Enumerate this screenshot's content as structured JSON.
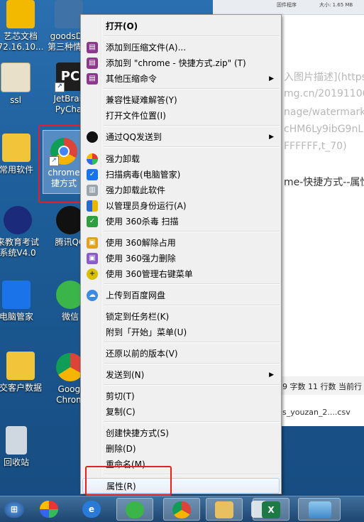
{
  "desktop_icons": [
    {
      "label1": "艺芯文档",
      "label2": "72.16.10...",
      "icon": "document-icon",
      "color": "#f2b900"
    },
    {
      "label1": "goodsDe",
      "label2": "第三种情况",
      "icon": "python-icon",
      "color": "#3f73a8"
    },
    {
      "label1": "ssl",
      "label2": "",
      "icon": "certificate-icon",
      "color": "#e8e0c8"
    },
    {
      "label1": "JetBrain",
      "label2": "PyChar",
      "icon": "pycharm-icon",
      "color": "#1e1e1e"
    },
    {
      "label1": "常用软件",
      "label2": "",
      "icon": "folder-icon",
      "color": "#f2c43a"
    },
    {
      "label1": "chrome",
      "label2": "捷方式",
      "icon": "chrome-icon",
      "color": "#db4437"
    },
    {
      "label1": "来教育考试",
      "label2": "系统V4.0",
      "icon": "exam-app-icon",
      "color": "#1b2a7a"
    },
    {
      "label1": "腾讯QQ",
      "label2": "",
      "icon": "qq-penguin-icon",
      "color": "#111"
    },
    {
      "label1": "电脑管家",
      "label2": "",
      "icon": "tencent-shield-icon",
      "color": "#1a73e8"
    },
    {
      "label1": "微信",
      "label2": "",
      "icon": "wechat-icon",
      "color": "#3bb54a"
    },
    {
      "label1": "交客户数据",
      "label2": "",
      "icon": "folder-icon",
      "color": "#f2c43a"
    },
    {
      "label1": "Googl",
      "label2": "Chrom",
      "icon": "chrome-icon",
      "color": "#db4437"
    },
    {
      "label1": "回收站",
      "label2": "",
      "icon": "recycle-bin-icon",
      "color": "#cfd8e0"
    }
  ],
  "background_window": {
    "topstrip_left": "固件程序",
    "topstrip_right": "大小: 1.65 MB",
    "lines": [
      "入图片描述](https",
      "mg.cn/201911061",
      "nage/watermark,ty",
      "cHM6Ly9ibG9nLm",
      "FFFFFF,t_70)"
    ],
    "dark_line": "me-快捷方式--属性",
    "status": "9 字数  11 行数  当前行",
    "csv_file": "s_youzan_2....csv"
  },
  "menu": {
    "items": [
      {
        "label": "打开(O)",
        "bold": true,
        "icon": "",
        "submenu": false
      },
      {
        "label": "添加到压缩文件(A)...",
        "icon": "winrar-icon",
        "submenu": false
      },
      {
        "label": "添加到 \"chrome - 快捷方式.zip\" (T)",
        "icon": "winrar-icon",
        "submenu": false
      },
      {
        "label": "其他压缩命令",
        "icon": "winrar-icon",
        "submenu": true
      },
      {
        "label": "兼容性疑难解答(Y)",
        "icon": "",
        "submenu": false
      },
      {
        "label": "打开文件位置(I)",
        "icon": "",
        "submenu": false
      },
      {
        "label": "通过QQ发送到",
        "icon": "qq-penguin-icon",
        "submenu": true
      },
      {
        "label": "强力卸载",
        "icon": "uninstall-icon",
        "submenu": false
      },
      {
        "label": "扫描病毒(电脑管家)",
        "icon": "tencent-shield-icon",
        "submenu": false
      },
      {
        "label": "强力卸载此软件",
        "icon": "trash-icon",
        "submenu": false
      },
      {
        "label": "以管理员身份运行(A)",
        "icon": "uac-shield-icon",
        "submenu": false
      },
      {
        "label": "使用 360杀毒 扫描",
        "icon": "360-antivirus-icon",
        "submenu": false
      },
      {
        "label": "使用 360解除占用",
        "icon": "360-unlock-icon",
        "submenu": false
      },
      {
        "label": "使用 360强力删除",
        "icon": "360-delete-icon",
        "submenu": false
      },
      {
        "label": "使用 360管理右键菜单",
        "icon": "360-menu-icon",
        "submenu": false
      },
      {
        "label": "上传到百度网盘",
        "icon": "baidu-cloud-icon",
        "submenu": false
      },
      {
        "label": "锁定到任务栏(K)",
        "icon": "",
        "submenu": false
      },
      {
        "label": "附到「开始」菜单(U)",
        "icon": "",
        "submenu": false
      },
      {
        "label": "还原以前的版本(V)",
        "icon": "",
        "submenu": false
      },
      {
        "label": "发送到(N)",
        "icon": "",
        "submenu": true
      },
      {
        "label": "剪切(T)",
        "icon": "",
        "submenu": false
      },
      {
        "label": "复制(C)",
        "icon": "",
        "submenu": false
      },
      {
        "label": "创建快捷方式(S)",
        "icon": "",
        "submenu": false
      },
      {
        "label": "删除(D)",
        "icon": "",
        "submenu": false
      },
      {
        "label": "重命名(M)",
        "icon": "",
        "submenu": false
      },
      {
        "label": "属性(R)",
        "icon": "",
        "submenu": false,
        "highlighted": true
      }
    ]
  },
  "taskbar": {
    "buttons": [
      {
        "icon": "windows-start-icon"
      },
      {
        "icon": "pinwheel-app-icon"
      },
      {
        "icon": "internet-explorer-icon"
      },
      {
        "icon": "wechat-icon"
      },
      {
        "icon": "chrome-icon"
      },
      {
        "icon": "file-explorer-icon"
      },
      {
        "icon": "maximized-window-icon"
      },
      {
        "icon": "excel-icon"
      },
      {
        "icon": "image-viewer-icon"
      }
    ]
  },
  "colors": {
    "highlight_box": "#e62020",
    "menu_bg": "#f0f0f0",
    "desktop": "#1f5f95"
  }
}
